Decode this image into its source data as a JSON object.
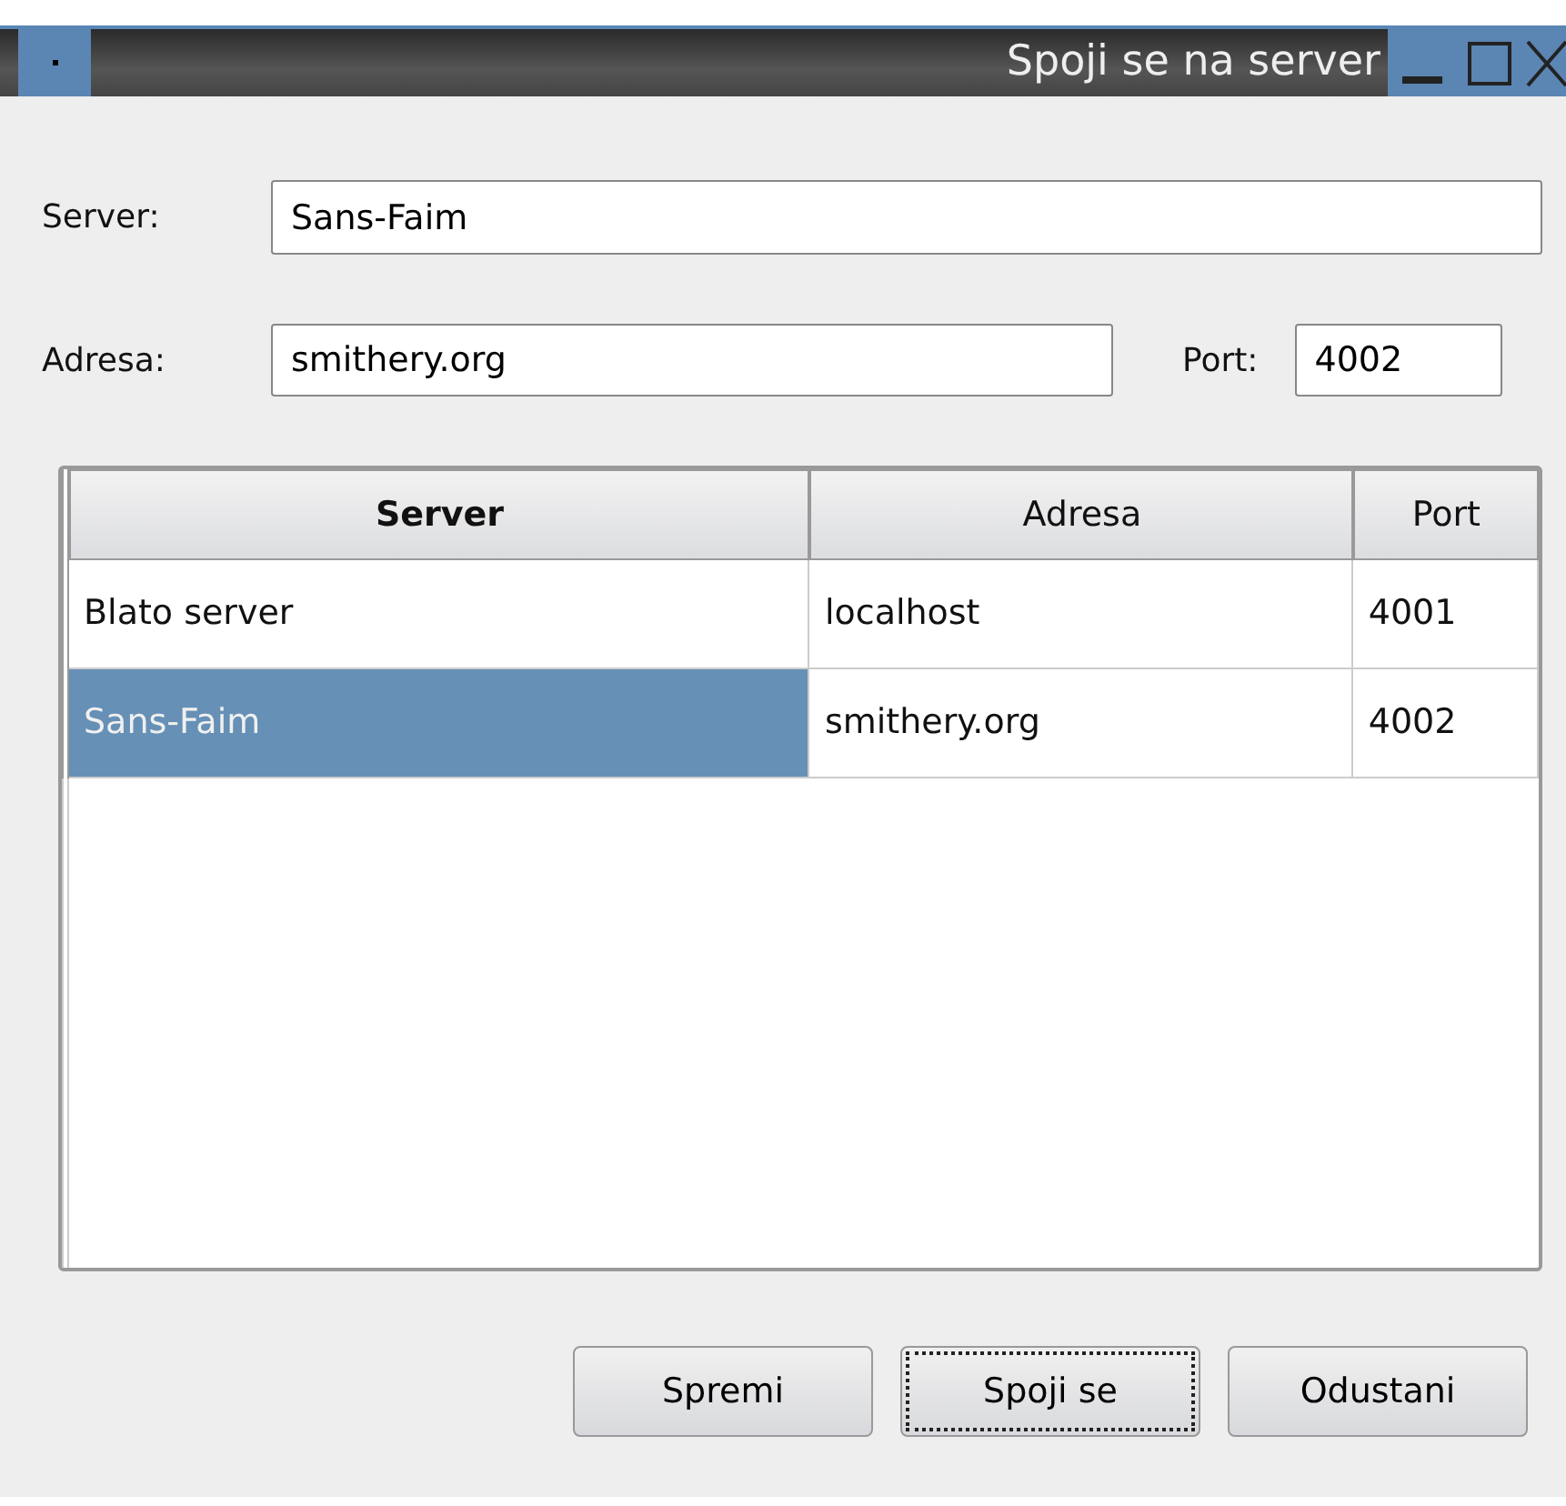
{
  "window": {
    "title": "Spoji se na server"
  },
  "fields": [
    {
      "label": "Server:",
      "value": "Sans-Faim"
    },
    {
      "label": "Adresa:",
      "value": "smithery.org"
    },
    {
      "label": "Port:",
      "value": "4002"
    }
  ],
  "table": {
    "columns": [
      {
        "label": "Server",
        "sorted": true
      },
      {
        "label": "Adresa",
        "sorted": false
      },
      {
        "label": "Port",
        "sorted": false
      }
    ],
    "rows": [
      {
        "cells": [
          "Blato server",
          "localhost",
          "4001"
        ],
        "selected": false
      },
      {
        "cells": [
          "Sans-Faim",
          "smithery.org",
          "4002"
        ],
        "selected": true
      }
    ]
  },
  "buttons": [
    {
      "label": "Spremi",
      "focused": false
    },
    {
      "label": "Spoji se",
      "focused": true
    },
    {
      "label": "Odustani",
      "focused": false
    }
  ]
}
